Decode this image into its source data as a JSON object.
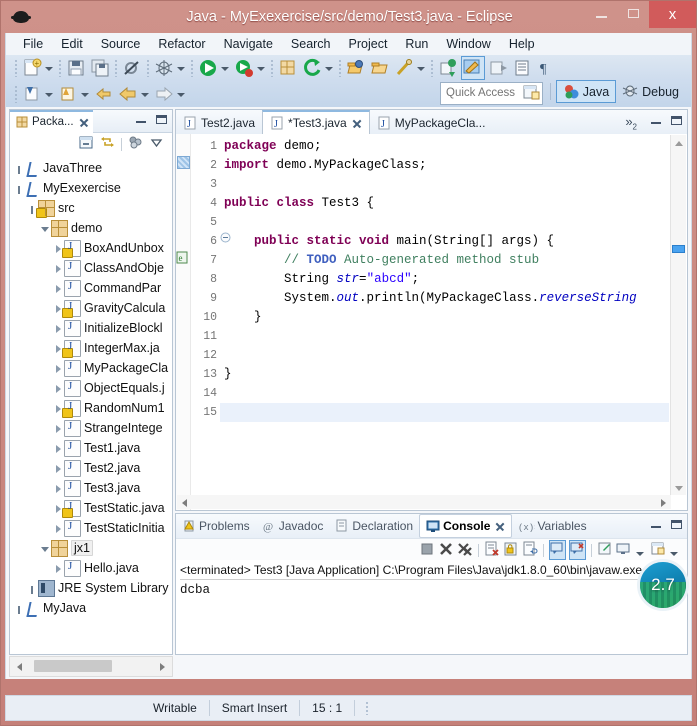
{
  "window": {
    "title": "Java - MyExexercise/src/demo/Test3.java - Eclipse",
    "minimize_label": "",
    "maximize_label": "",
    "close_label": "x"
  },
  "menu": [
    "File",
    "Edit",
    "Source",
    "Refactor",
    "Navigate",
    "Search",
    "Project",
    "Run",
    "Window",
    "Help"
  ],
  "toolbar": {
    "quick_access_placeholder": "Quick Access",
    "quick_access_value": "",
    "perspectives": [
      {
        "label": "Java",
        "active": true,
        "icon": "java-perspective-icon"
      },
      {
        "label": "Debug",
        "active": false,
        "icon": "debug-perspective-icon"
      }
    ],
    "row1_icons": [
      "new-wizard-icon",
      "save-icon",
      "save-all-icon",
      "skip-breakpoints-icon",
      "debug-icon",
      "run-icon",
      "run-coverage-icon",
      "new-java-package-icon",
      "external-tools-icon",
      "open-type-icon",
      "open-task-icon",
      "search-icon",
      "last-edit-location-icon",
      "toggle-mark-occurrences-icon",
      "next-annotation-icon",
      "previous-annotation-icon",
      "show-whitespace-icon"
    ],
    "row2_icons": [
      "back-icon",
      "forward-icon",
      "previous-edit-icon",
      "back-history-icon",
      "forward-history-icon"
    ]
  },
  "package_explorer": {
    "tab_label": "Packa...",
    "close_icon": "close-icon",
    "toolbar_icons": [
      "collapse-all-icon",
      "link-with-editor-icon",
      "view-menu-icon",
      "view-dropdown-icon"
    ],
    "minimize_icon": "minimize-icon",
    "maximize_icon": "maximize-icon",
    "tree": [
      {
        "label": "JavaThree",
        "indent": 0,
        "icon": "java-project-icon",
        "twisty": "plus",
        "selected": false
      },
      {
        "label": "MyExexercise",
        "indent": 0,
        "icon": "java-project-icon",
        "twisty": "plus",
        "selected": false
      },
      {
        "label": "src",
        "indent": 1,
        "icon": "source-folder-icon",
        "twisty": "plus",
        "selected": false
      },
      {
        "label": "demo",
        "indent": 2,
        "icon": "package-icon",
        "twisty": "open",
        "selected": false
      },
      {
        "label": "BoxAndUnbox",
        "indent": 3,
        "icon": "java-file-warning-icon",
        "twisty": "closed",
        "selected": false
      },
      {
        "label": "ClassAndObje",
        "indent": 3,
        "icon": "java-file-icon",
        "twisty": "closed",
        "selected": false
      },
      {
        "label": "CommandPar",
        "indent": 3,
        "icon": "java-file-icon",
        "twisty": "closed",
        "selected": false
      },
      {
        "label": "GravityCalcula",
        "indent": 3,
        "icon": "java-file-warning-icon",
        "twisty": "closed",
        "selected": false
      },
      {
        "label": "InitializeBlockl",
        "indent": 3,
        "icon": "java-file-icon",
        "twisty": "closed",
        "selected": false
      },
      {
        "label": "IntegerMax.ja",
        "indent": 3,
        "icon": "java-file-warning-icon",
        "twisty": "closed",
        "selected": false
      },
      {
        "label": "MyPackageCla",
        "indent": 3,
        "icon": "java-file-icon",
        "twisty": "closed",
        "selected": false
      },
      {
        "label": "ObjectEquals.j",
        "indent": 3,
        "icon": "java-file-icon",
        "twisty": "closed",
        "selected": false
      },
      {
        "label": "RandomNum1",
        "indent": 3,
        "icon": "java-file-warning-icon",
        "twisty": "closed",
        "selected": false
      },
      {
        "label": "StrangeIntege",
        "indent": 3,
        "icon": "java-file-icon",
        "twisty": "closed",
        "selected": false
      },
      {
        "label": "Test1.java",
        "indent": 3,
        "icon": "java-file-icon",
        "twisty": "closed",
        "selected": false
      },
      {
        "label": "Test2.java",
        "indent": 3,
        "icon": "java-file-icon",
        "twisty": "closed",
        "selected": false
      },
      {
        "label": "Test3.java",
        "indent": 3,
        "icon": "java-file-icon",
        "twisty": "closed",
        "selected": false
      },
      {
        "label": "TestStatic.java",
        "indent": 3,
        "icon": "java-file-warning-icon",
        "twisty": "closed",
        "selected": false
      },
      {
        "label": "TestStaticInitia",
        "indent": 3,
        "icon": "java-file-icon",
        "twisty": "closed",
        "selected": false
      },
      {
        "label": "jx1",
        "indent": 2,
        "icon": "package-icon",
        "twisty": "open",
        "selected": true
      },
      {
        "label": "Hello.java",
        "indent": 3,
        "icon": "java-file-icon",
        "twisty": "closed",
        "selected": false
      },
      {
        "label": "JRE System Library [",
        "indent": 1,
        "icon": "library-icon",
        "twisty": "plus",
        "selected": false
      },
      {
        "label": "MyJava",
        "indent": 0,
        "icon": "java-project-icon",
        "twisty": "plus",
        "selected": false
      }
    ]
  },
  "editor": {
    "tabs": [
      {
        "label": "Test2.java",
        "active": false,
        "dirty": false,
        "icon": "java-file-icon"
      },
      {
        "label": "*Test3.java",
        "active": true,
        "dirty": true,
        "icon": "java-file-icon",
        "close_icon": "close-icon"
      },
      {
        "label": "MyPackageCla...",
        "active": false,
        "dirty": false,
        "icon": "java-file-icon"
      }
    ],
    "overflow_label": "»",
    "overflow_count": "2",
    "minimize_icon": "minimize-icon",
    "maximize_icon": "maximize-icon",
    "line_numbers": [
      "1",
      "2",
      "3",
      "4",
      "5",
      "6",
      "7",
      "8",
      "9",
      "10",
      "11",
      "12",
      "13",
      "14",
      "15"
    ],
    "highlighted_line": 15,
    "fold_marker_line": 6,
    "lines": [
      {
        "n": 1,
        "tokens": [
          {
            "t": "package ",
            "c": "kw"
          },
          {
            "t": "demo;",
            "c": ""
          }
        ]
      },
      {
        "n": 2,
        "tokens": [
          {
            "t": "import ",
            "c": "kw"
          },
          {
            "t": "demo.MyPackageClass;",
            "c": ""
          }
        ]
      },
      {
        "n": 3,
        "tokens": []
      },
      {
        "n": 4,
        "tokens": [
          {
            "t": "public class ",
            "c": "kw"
          },
          {
            "t": "Test3 {",
            "c": ""
          }
        ]
      },
      {
        "n": 5,
        "tokens": []
      },
      {
        "n": 6,
        "tokens": [
          {
            "t": "    public static void ",
            "c": "kw"
          },
          {
            "t": "main(String[] args) {",
            "c": ""
          }
        ]
      },
      {
        "n": 7,
        "tokens": [
          {
            "t": "        // ",
            "c": "cm"
          },
          {
            "t": "TODO",
            "c": "todo"
          },
          {
            "t": " Auto-generated method stub",
            "c": "cm"
          }
        ]
      },
      {
        "n": 8,
        "tokens": [
          {
            "t": "        String ",
            "c": ""
          },
          {
            "t": "str",
            "c": "fld"
          },
          {
            "t": "=",
            "c": ""
          },
          {
            "t": "\"abcd\"",
            "c": "str"
          },
          {
            "t": ";",
            "c": ""
          }
        ]
      },
      {
        "n": 9,
        "tokens": [
          {
            "t": "        System.",
            "c": ""
          },
          {
            "t": "out",
            "c": "fld"
          },
          {
            "t": ".println(MyPackageClass.",
            "c": ""
          },
          {
            "t": "reverseString",
            "c": "stat"
          }
        ]
      },
      {
        "n": 10,
        "tokens": [
          {
            "t": "    }",
            "c": ""
          }
        ]
      },
      {
        "n": 11,
        "tokens": []
      },
      {
        "n": 12,
        "tokens": []
      },
      {
        "n": 13,
        "tokens": [
          {
            "t": "}",
            "c": ""
          }
        ]
      },
      {
        "n": 14,
        "tokens": []
      },
      {
        "n": 15,
        "tokens": []
      }
    ]
  },
  "console_panel": {
    "tabs": [
      {
        "label": "Problems",
        "active": false,
        "icon": "problems-icon"
      },
      {
        "label": "Javadoc",
        "active": false,
        "icon": "javadoc-icon"
      },
      {
        "label": "Declaration",
        "active": false,
        "icon": "declaration-icon"
      },
      {
        "label": "Console",
        "active": true,
        "icon": "console-icon",
        "close_icon": "close-icon"
      },
      {
        "label": "Variables",
        "active": false,
        "icon": "variables-icon"
      }
    ],
    "minimize_icon": "minimize-icon",
    "maximize_icon": "maximize-icon",
    "toolbar_icons": [
      "terminate-icon",
      "remove-launch-icon",
      "remove-all-terminated-icon",
      "clear-console-icon",
      "lock-scroll-icon",
      "word-wrap-icon",
      "show-console-on-output-icon",
      "show-console-on-error-icon",
      "pin-console-icon",
      "display-selected-console-icon",
      "display-selected-dropdown-icon",
      "open-console-icon",
      "open-console-dropdown-icon"
    ],
    "output": {
      "header": "<terminated> Test3 [Java Application] C:\\Program Files\\Java\\jdk1.8.0_60\\bin\\javaw.exe (",
      "lines": [
        "dcba"
      ]
    }
  },
  "status_bar": {
    "writable": "Writable",
    "insert_mode": "Smart Insert",
    "cursor_position": "15 : 1"
  },
  "overlay_badge": {
    "value": "2.7"
  },
  "colors": {
    "title_bar": "#c98b83",
    "toolbar": "#cfddee",
    "accent_blue": "#5b9bd5",
    "keyword": "#7f0055",
    "comment": "#3f7f5f",
    "todo": "#3f5fbf",
    "string": "#2a00ff",
    "field": "#0000c0",
    "close_button": "#d15b5b",
    "selection": "#eaf1fb"
  }
}
